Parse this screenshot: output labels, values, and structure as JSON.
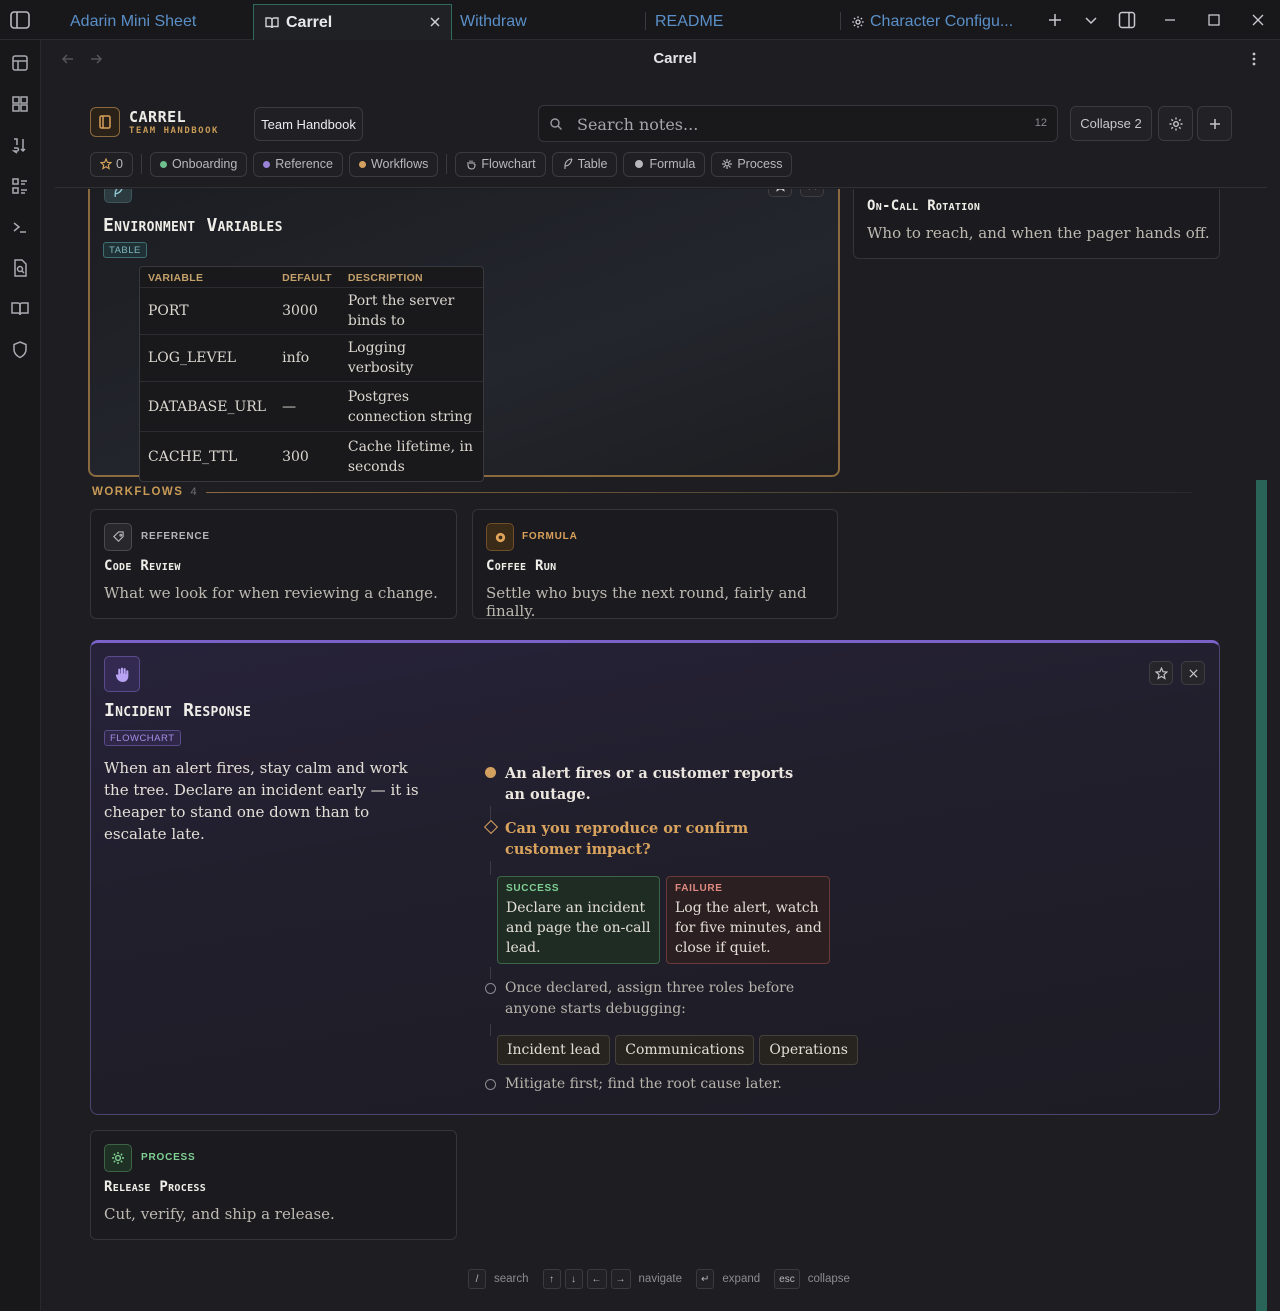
{
  "tabs": [
    {
      "label": "Adarin Mini Sheet"
    },
    {
      "label": "Carrel"
    },
    {
      "label": "Withdraw"
    },
    {
      "label": "README"
    },
    {
      "label": "Character Configu..."
    }
  ],
  "view": {
    "title": "Carrel"
  },
  "brand": {
    "name": "CARREL",
    "subtitle": "TEAM HANDBOOK"
  },
  "toolbar": {
    "handbook_label": "Team Handbook",
    "search_placeholder": "Search notes...",
    "search_count": "12",
    "collapse_label": "Collapse 2"
  },
  "chips": {
    "starred": "0",
    "categories": [
      {
        "label": "Onboarding",
        "color": "#6fbf8f"
      },
      {
        "label": "Reference",
        "color": "#9a83d9"
      },
      {
        "label": "Workflows",
        "color": "#d4a05f"
      }
    ],
    "types": [
      {
        "label": "Flowchart",
        "icon": "hand-icon"
      },
      {
        "label": "Table",
        "icon": "feather-icon"
      },
      {
        "label": "Formula",
        "icon": "flask-icon"
      },
      {
        "label": "Process",
        "icon": "gear-icon"
      }
    ]
  },
  "env_card": {
    "title": "Environment Variables",
    "tag": "TABLE",
    "columns": [
      "VARIABLE",
      "DEFAULT",
      "DESCRIPTION"
    ],
    "rows": [
      [
        "PORT",
        "3000",
        "Port the server binds to"
      ],
      [
        "LOG_LEVEL",
        "info",
        "Logging verbosity"
      ],
      [
        "DATABASE_URL",
        "—",
        "Postgres connection string"
      ],
      [
        "CACHE_TTL",
        "300",
        "Cache lifetime, in seconds"
      ]
    ]
  },
  "oncall_card": {
    "title": "On-Call Rotation",
    "desc": "Who to reach, and when the pager hands off."
  },
  "workflows_section": {
    "label": "WORKFLOWS",
    "count": "4"
  },
  "code_review_card": {
    "kind": "REFERENCE",
    "title": "Code Review",
    "desc": "What we look for when reviewing a change."
  },
  "coffee_card": {
    "kind": "FORMULA",
    "title": "Coffee Run",
    "desc": "Settle who buys the next round, fairly and finally."
  },
  "incident_card": {
    "title": "Incident Response",
    "tag": "FLOWCHART",
    "intro": "When an alert fires, stay calm and work the tree. Declare an incident early — it is cheaper to stand one down than to escalate late.",
    "start": "An alert fires or a customer reports an outage.",
    "question": "Can you reproduce or confirm customer impact?",
    "success_label": "SUCCESS",
    "success_text": "Declare an incident and page the on-call lead.",
    "failure_label": "FAILURE",
    "failure_text": "Log the alert, watch for five minutes, and close if quiet.",
    "step_roles": "Once declared, assign three roles before anyone starts debugging:",
    "roles": [
      "Incident lead",
      "Communications",
      "Operations"
    ],
    "step_last": "Mitigate first; find the root cause later."
  },
  "release_card": {
    "kind": "PROCESS",
    "title": "Release Process",
    "desc": "Cut, verify, and ship a release."
  },
  "hints": {
    "search_key": "/",
    "search": "search",
    "up_key": "↑",
    "down_key": "↓",
    "left_key": "←",
    "right_key": "→",
    "navigate": "navigate",
    "enter_key": "↵",
    "expand": "expand",
    "esc_key": "esc",
    "collapse": "collapse"
  },
  "colors": {
    "accent": "#c89a56",
    "teal": "#2a6458",
    "violet": "#8a72d6"
  }
}
